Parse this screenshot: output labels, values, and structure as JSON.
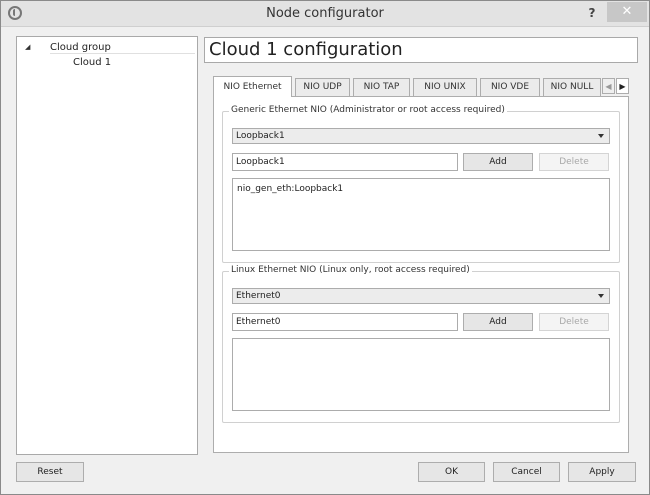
{
  "window": {
    "title": "Node configurator",
    "help_label": "?",
    "close_label": "✕",
    "icon": "app-icon"
  },
  "tree": {
    "group_label": "Cloud group",
    "expand_glyph": "◢",
    "child_label": "Cloud 1"
  },
  "panel": {
    "title": "Cloud 1 configuration"
  },
  "tabs": [
    {
      "label": "NIO Ethernet",
      "active": true
    },
    {
      "label": "NIO UDP"
    },
    {
      "label": "NIO TAP"
    },
    {
      "label": "NIO UNIX"
    },
    {
      "label": "NIO VDE"
    },
    {
      "label": "NIO NULL"
    }
  ],
  "tab_scroll": {
    "left": "◀",
    "right": "▶"
  },
  "generic": {
    "group_title": "Generic Ethernet NIO (Administrator or root access required)",
    "combo_value": "Loopback1",
    "input_value": "Loopback1",
    "add_label": "Add",
    "delete_label": "Delete",
    "list_items": [
      "nio_gen_eth:Loopback1"
    ]
  },
  "linux": {
    "group_title": "Linux Ethernet NIO (Linux only, root access required)",
    "combo_value": "Ethernet0",
    "input_value": "Ethernet0",
    "add_label": "Add",
    "delete_label": "Delete",
    "list_items": []
  },
  "footer": {
    "reset_label": "Reset",
    "ok_label": "OK",
    "cancel_label": "Cancel",
    "apply_label": "Apply"
  }
}
